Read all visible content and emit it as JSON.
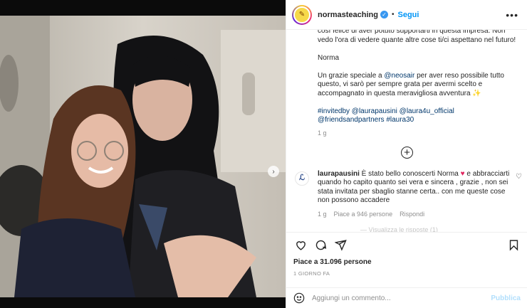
{
  "post": {
    "username": "normasteaching",
    "follow_label": "Segui",
    "more_label": "•••"
  },
  "caption": {
    "line1": "così felice di aver potuto supportarti in questa impresa. Non vedo l'ora di vedere quante altre cose ti/ci aspettano nel futuro!",
    "signoff": "Norma",
    "thanks_pre": "Un grazie speciale a ",
    "thanks_mention": "@neosair",
    "thanks_post": " per aver reso possibile tutto questo, vi sarò per sempre grata per avermi scelto e accompagnato in questa meravigliosa avventura ",
    "sparkle": "✨",
    "hashtags": "#invitedby @laurapausini @laura4u_official @friendsandpartners #laura30",
    "time": "1 g"
  },
  "comment": {
    "user": "laurapausini",
    "text_pre": " È stato bello conoscerti Norma ",
    "heart": "♥",
    "text_post": " e abbracciarti quando ho capito quanto sei vera e sincera , grazie , non sei stata invitata per sbaglio stanne certa.. con me queste cose non possono accadere",
    "time": "1 g",
    "likes": "Piace a 946 persone",
    "reply": "Rispondi",
    "faded": "— Visualizza le risposte (1)"
  },
  "footer": {
    "likes": "Piace a 31.096 persone",
    "date": "1 GIORNO FA",
    "placeholder": "Aggiungi un commento...",
    "publish": "Pubblica"
  },
  "icons": [
    "like-heart-icon",
    "comment-icon",
    "share-icon",
    "save-icon",
    "emoji-icon",
    "add-icon",
    "verified-icon",
    "chevron-right-icon"
  ],
  "carousel": {
    "count": 8,
    "active": 0
  },
  "colors": {
    "link": "#00376b",
    "accent": "#0095f6",
    "publish": "#b2dffc",
    "heart": "#e0245e"
  }
}
